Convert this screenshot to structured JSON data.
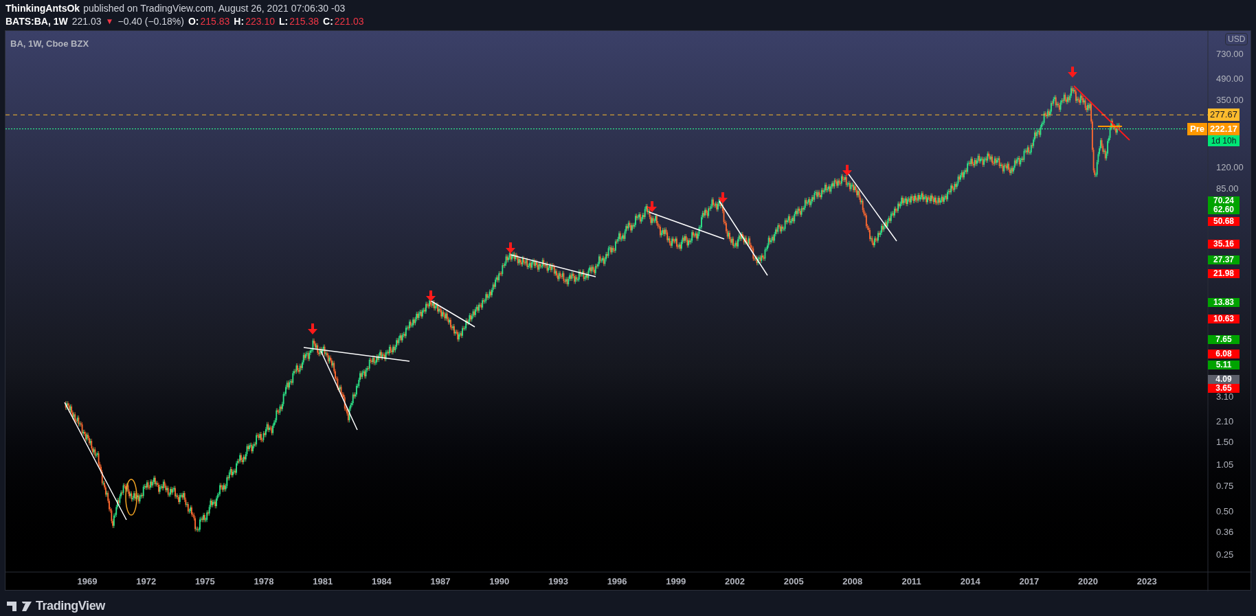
{
  "header": {
    "author": "ThinkingAntsOk",
    "published": "published on TradingView.com, August 26, 2021 07:06:30 -03",
    "symbol": "BATS:BA, 1W",
    "last": "221.03",
    "direction": "▼",
    "change": "−0.40 (−0.18%)",
    "ohlc": [
      {
        "label": "O:",
        "value": "215.83"
      },
      {
        "label": "H:",
        "value": "223.10"
      },
      {
        "label": "L:",
        "value": "215.38"
      },
      {
        "label": "C:",
        "value": "221.03"
      }
    ]
  },
  "chart": {
    "legend": "BA, 1W, Cboe BZX",
    "currency": "USD",
    "price_ticks": [
      "730.00",
      "490.00",
      "350.00",
      "120.00",
      "85.00",
      "3.10",
      "2.10",
      "1.50",
      "1.05",
      "0.75",
      "0.50",
      "0.36",
      "0.25"
    ],
    "time_ticks": [
      "1969",
      "1972",
      "1975",
      "1978",
      "1981",
      "1984",
      "1987",
      "1990",
      "1993",
      "1996",
      "1999",
      "2002",
      "2005",
      "2008",
      "2011",
      "2014",
      "2017",
      "2020",
      "2023"
    ],
    "last_price": {
      "text": "277.67",
      "color": "#fdbb2d"
    },
    "session": {
      "label": "Pre",
      "price": "222.17",
      "countdown": "1d 10h"
    },
    "price_badges": [
      {
        "text": "70.24",
        "color": "#00a300"
      },
      {
        "text": "62.60",
        "color": "#00a300"
      },
      {
        "text": "50.68",
        "color": "#ff0000"
      },
      {
        "text": "35.16",
        "color": "#ff0000"
      },
      {
        "text": "27.37",
        "color": "#00a300"
      },
      {
        "text": "21.98",
        "color": "#ff0000"
      },
      {
        "text": "13.83",
        "color": "#00a300"
      },
      {
        "text": "10.63",
        "color": "#ff0000"
      },
      {
        "text": "7.65",
        "color": "#00a300"
      },
      {
        "text": "6.08",
        "color": "#ff0000"
      },
      {
        "text": "5.11",
        "color": "#00a300"
      },
      {
        "text": "4.09",
        "color": "#5d606b"
      },
      {
        "text": "3.65",
        "color": "#ff0000"
      }
    ]
  },
  "footer": {
    "logo": "TradingView"
  }
}
